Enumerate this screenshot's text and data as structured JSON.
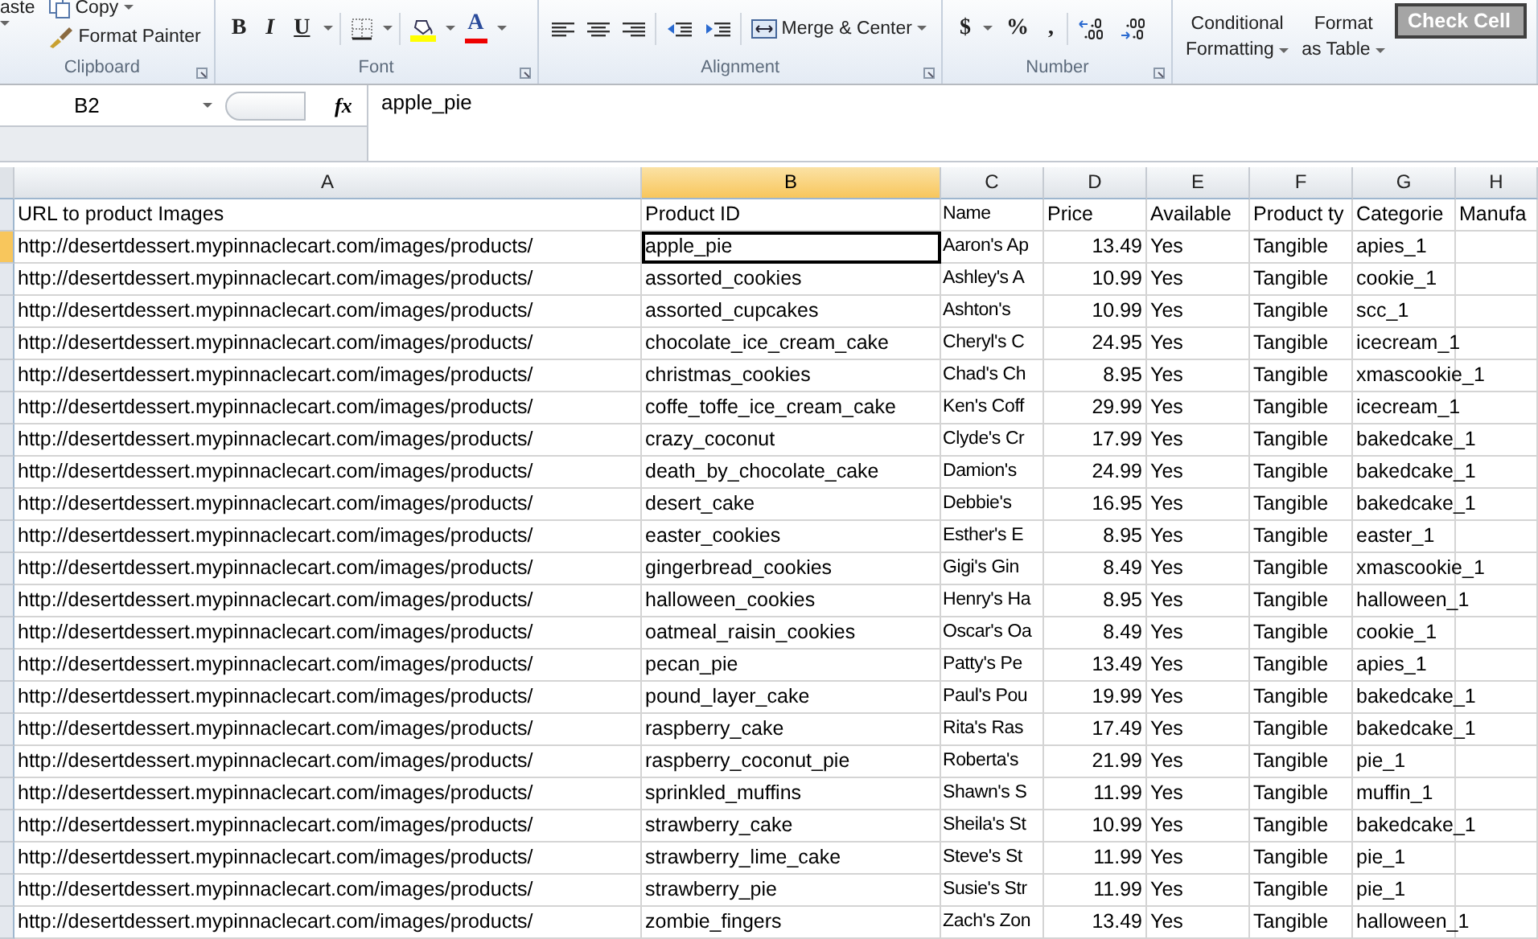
{
  "ribbon": {
    "groups": [
      {
        "label": "Clipboard",
        "items": [
          {
            "kind": "paste",
            "label": "aste"
          },
          {
            "kind": "copy",
            "label": "Copy"
          },
          {
            "kind": "painter",
            "label": "Format Painter"
          }
        ]
      },
      {
        "label": "Font",
        "items": [
          {
            "kind": "bold",
            "label": "B"
          },
          {
            "kind": "italic",
            "label": "I"
          },
          {
            "kind": "underline",
            "label": "U"
          },
          {
            "kind": "borders"
          },
          {
            "kind": "fill"
          },
          {
            "kind": "font-color",
            "label": "A"
          }
        ]
      },
      {
        "label": "Alignment",
        "items": [
          {
            "kind": "align-left"
          },
          {
            "kind": "align-center"
          },
          {
            "kind": "align-right"
          },
          {
            "kind": "outdent"
          },
          {
            "kind": "indent"
          },
          {
            "kind": "merge",
            "label": "Merge & Center"
          }
        ]
      },
      {
        "label": "Number",
        "items": [
          {
            "kind": "currency",
            "label": "$"
          },
          {
            "kind": "symbol",
            "label": "%"
          },
          {
            "kind": "symbol",
            "label": ","
          },
          {
            "kind": "inc-decimal"
          },
          {
            "kind": "dec-decimal"
          }
        ]
      },
      {
        "items": [
          {
            "kind": "stacked",
            "lines": [
              "Conditional",
              "Formatting"
            ]
          },
          {
            "kind": "stacked",
            "lines": [
              "Format",
              "as Table"
            ]
          },
          {
            "kind": "style-cell",
            "label": "Check Cell"
          }
        ]
      }
    ]
  },
  "formula_bar": {
    "name_box": "B2",
    "function_label": "fx",
    "value": "apple_pie"
  },
  "sheet": {
    "columns": [
      {
        "label": "A",
        "selected": false
      },
      {
        "label": "B",
        "selected": true
      },
      {
        "label": "C",
        "selected": false
      },
      {
        "label": "D",
        "selected": false,
        "kind": "number"
      },
      {
        "label": "E",
        "selected": false
      },
      {
        "label": "F",
        "selected": false
      },
      {
        "label": "G",
        "selected": false
      },
      {
        "label": "H",
        "selected": false
      }
    ],
    "rows": [
      {
        "selected": false,
        "cells": [
          "URL to product Images",
          "Product ID",
          "Name",
          "Price",
          "Available",
          "Product ty",
          "Categorie",
          "Manufa"
        ]
      },
      {
        "selected": true,
        "cells": [
          "http://desertdessert.mypinnaclecart.com/images/products/",
          "apple_pie",
          "Aaron's Ap",
          "13.49",
          "Yes",
          "Tangible",
          "apies_1"
        ]
      },
      {
        "selected": false,
        "cells": [
          "http://desertdessert.mypinnaclecart.com/images/products/",
          "assorted_cookies",
          "Ashley's A",
          "10.99",
          "Yes",
          "Tangible",
          "cookie_1"
        ]
      },
      {
        "selected": false,
        "cells": [
          "http://desertdessert.mypinnaclecart.com/images/products/",
          "assorted_cupcakes",
          "Ashton's",
          "10.99",
          "Yes",
          "Tangible",
          "scc_1"
        ]
      },
      {
        "selected": false,
        "cells": [
          "http://desertdessert.mypinnaclecart.com/images/products/",
          "chocolate_ice_cream_cake",
          "Cheryl's C",
          "24.95",
          "Yes",
          "Tangible",
          "icecream_1"
        ]
      },
      {
        "selected": false,
        "cells": [
          "http://desertdessert.mypinnaclecart.com/images/products/",
          "christmas_cookies",
          "Chad's Ch",
          "8.95",
          "Yes",
          "Tangible",
          "xmascookie_1"
        ]
      },
      {
        "selected": false,
        "cells": [
          "http://desertdessert.mypinnaclecart.com/images/products/",
          "coffe_toffe_ice_cream_cake",
          "Ken's Coff",
          "29.99",
          "Yes",
          "Tangible",
          "icecream_1"
        ]
      },
      {
        "selected": false,
        "cells": [
          "http://desertdessert.mypinnaclecart.com/images/products/",
          "crazy_coconut",
          "Clyde's Cr",
          "17.99",
          "Yes",
          "Tangible",
          "bakedcake_1"
        ]
      },
      {
        "selected": false,
        "cells": [
          "http://desertdessert.mypinnaclecart.com/images/products/",
          "death_by_chocolate_cake",
          "Damion's",
          "24.99",
          "Yes",
          "Tangible",
          "bakedcake_1"
        ]
      },
      {
        "selected": false,
        "cells": [
          "http://desertdessert.mypinnaclecart.com/images/products/",
          "desert_cake",
          "Debbie's",
          "16.95",
          "Yes",
          "Tangible",
          "bakedcake_1"
        ]
      },
      {
        "selected": false,
        "cells": [
          "http://desertdessert.mypinnaclecart.com/images/products/",
          "easter_cookies",
          "Esther's E",
          "8.95",
          "Yes",
          "Tangible",
          "easter_1"
        ]
      },
      {
        "selected": false,
        "cells": [
          "http://desertdessert.mypinnaclecart.com/images/products/",
          "gingerbread_cookies",
          "Gigi's Gin",
          "8.49",
          "Yes",
          "Tangible",
          "xmascookie_1"
        ]
      },
      {
        "selected": false,
        "cells": [
          "http://desertdessert.mypinnaclecart.com/images/products/",
          "halloween_cookies",
          "Henry's Ha",
          "8.95",
          "Yes",
          "Tangible",
          "halloween_1"
        ]
      },
      {
        "selected": false,
        "cells": [
          "http://desertdessert.mypinnaclecart.com/images/products/",
          "oatmeal_raisin_cookies",
          "Oscar's Oa",
          "8.49",
          "Yes",
          "Tangible",
          "cookie_1"
        ]
      },
      {
        "selected": false,
        "cells": [
          "http://desertdessert.mypinnaclecart.com/images/products/",
          "pecan_pie",
          "Patty's Pe",
          "13.49",
          "Yes",
          "Tangible",
          "apies_1"
        ]
      },
      {
        "selected": false,
        "cells": [
          "http://desertdessert.mypinnaclecart.com/images/products/",
          "pound_layer_cake",
          "Paul's Pou",
          "19.99",
          "Yes",
          "Tangible",
          "bakedcake_1"
        ]
      },
      {
        "selected": false,
        "cells": [
          "http://desertdessert.mypinnaclecart.com/images/products/",
          "raspberry_cake",
          "Rita's Ras",
          "17.49",
          "Yes",
          "Tangible",
          "bakedcake_1"
        ]
      },
      {
        "selected": false,
        "cells": [
          "http://desertdessert.mypinnaclecart.com/images/products/",
          "raspberry_coconut_pie",
          "Roberta's",
          "21.99",
          "Yes",
          "Tangible",
          "pie_1"
        ]
      },
      {
        "selected": false,
        "cells": [
          "http://desertdessert.mypinnaclecart.com/images/products/",
          "sprinkled_muffins",
          "Shawn's S",
          "11.99",
          "Yes",
          "Tangible",
          "muffin_1"
        ]
      },
      {
        "selected": false,
        "cells": [
          "http://desertdessert.mypinnaclecart.com/images/products/",
          "strawberry_cake",
          "Sheila's St",
          "10.99",
          "Yes",
          "Tangible",
          "bakedcake_1"
        ]
      },
      {
        "selected": false,
        "cells": [
          "http://desertdessert.mypinnaclecart.com/images/products/",
          "strawberry_lime_cake",
          "Steve's St",
          "11.99",
          "Yes",
          "Tangible",
          "pie_1"
        ]
      },
      {
        "selected": false,
        "cells": [
          "http://desertdessert.mypinnaclecart.com/images/products/",
          "strawberry_pie",
          "Susie's Str",
          "11.99",
          "Yes",
          "Tangible",
          "pie_1"
        ]
      },
      {
        "selected": false,
        "cells": [
          "http://desertdessert.mypinnaclecart.com/images/products/",
          "zombie_fingers",
          "Zach's Zon",
          "13.49",
          "Yes",
          "Tangible",
          "halloween_1"
        ]
      }
    ]
  }
}
